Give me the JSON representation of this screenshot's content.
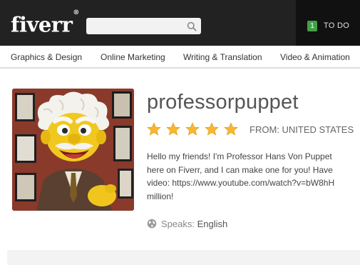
{
  "header": {
    "logo": "fiverr",
    "logo_mark": "®",
    "search_placeholder": "",
    "todo_count": "1",
    "todo_label": "TO DO"
  },
  "nav": {
    "items": [
      "Graphics & Design",
      "Online Marketing",
      "Writing & Translation",
      "Video & Animation"
    ]
  },
  "profile": {
    "username": "professorpuppet",
    "rating_stars": 5,
    "from": "FROM: UNITED STATES",
    "bio_lines": [
      "Hello my friends! I'm Professor Hans Von Puppet",
      "here on Fiverr, and I can make one for you! Have",
      "video: https://www.youtube.com/watch?v=bW8hH",
      "million!"
    ],
    "speaks_label": "Speaks:",
    "speaks_value": "English"
  },
  "colors": {
    "header_bg": "#222222",
    "star": "#f7b731",
    "todo_badge": "#43a047"
  },
  "icons": {
    "search": "search-icon",
    "star": "star-icon",
    "globe": "globe-icon"
  }
}
